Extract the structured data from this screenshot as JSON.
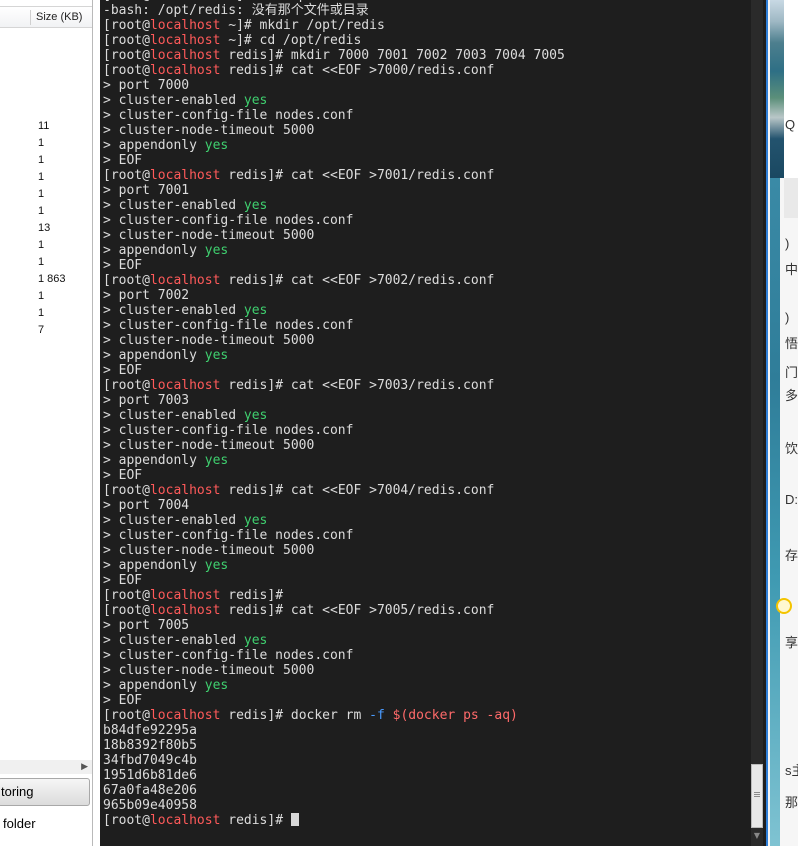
{
  "file_panel": {
    "size_column_header": "Size (KB)",
    "sizes": [
      "11",
      "1",
      "1",
      "1",
      "1",
      "1",
      "13",
      "1",
      "1",
      "1 863",
      "1",
      "1",
      "7"
    ],
    "storing_button_label": "toring",
    "folder_label": "folder"
  },
  "terminal": {
    "lines": [
      [
        {
          "t": "[root@"
        },
        {
          "t": "localhost",
          "c": "host"
        },
        {
          "t": " ~]# cd /opt/redis"
        }
      ],
      [
        {
          "t": "-bash: /opt/redis: 没有那个文件或目录"
        }
      ],
      [
        {
          "t": "[root@"
        },
        {
          "t": "localhost",
          "c": "host"
        },
        {
          "t": " ~]# mkdir /opt/redis"
        }
      ],
      [
        {
          "t": "[root@"
        },
        {
          "t": "localhost",
          "c": "host"
        },
        {
          "t": " ~]# cd /opt/redis"
        }
      ],
      [
        {
          "t": "[root@"
        },
        {
          "t": "localhost",
          "c": "host"
        },
        {
          "t": " redis]# mkdir 7000 7001 7002 7003 7004 7005"
        }
      ],
      [
        {
          "t": "[root@"
        },
        {
          "t": "localhost",
          "c": "host"
        },
        {
          "t": " redis]# cat <<EOF >7000/redis.conf"
        }
      ],
      [
        {
          "t": "> port 7000"
        }
      ],
      [
        {
          "t": "> cluster-enabled "
        },
        {
          "t": "yes",
          "c": "yes"
        }
      ],
      [
        {
          "t": "> cluster-config-file nodes.conf"
        }
      ],
      [
        {
          "t": "> cluster-node-timeout 5000"
        }
      ],
      [
        {
          "t": "> appendonly "
        },
        {
          "t": "yes",
          "c": "yes"
        }
      ],
      [
        {
          "t": "> EOF"
        }
      ],
      [
        {
          "t": "[root@"
        },
        {
          "t": "localhost",
          "c": "host"
        },
        {
          "t": " redis]# cat <<EOF >7001/redis.conf"
        }
      ],
      [
        {
          "t": "> port 7001"
        }
      ],
      [
        {
          "t": "> cluster-enabled "
        },
        {
          "t": "yes",
          "c": "yes"
        }
      ],
      [
        {
          "t": "> cluster-config-file nodes.conf"
        }
      ],
      [
        {
          "t": "> cluster-node-timeout 5000"
        }
      ],
      [
        {
          "t": "> appendonly "
        },
        {
          "t": "yes",
          "c": "yes"
        }
      ],
      [
        {
          "t": "> EOF"
        }
      ],
      [
        {
          "t": "[root@"
        },
        {
          "t": "localhost",
          "c": "host"
        },
        {
          "t": " redis]# cat <<EOF >7002/redis.conf"
        }
      ],
      [
        {
          "t": "> port 7002"
        }
      ],
      [
        {
          "t": "> cluster-enabled "
        },
        {
          "t": "yes",
          "c": "yes"
        }
      ],
      [
        {
          "t": "> cluster-config-file nodes.conf"
        }
      ],
      [
        {
          "t": "> cluster-node-timeout 5000"
        }
      ],
      [
        {
          "t": "> appendonly "
        },
        {
          "t": "yes",
          "c": "yes"
        }
      ],
      [
        {
          "t": "> EOF"
        }
      ],
      [
        {
          "t": "[root@"
        },
        {
          "t": "localhost",
          "c": "host"
        },
        {
          "t": " redis]# cat <<EOF >7003/redis.conf"
        }
      ],
      [
        {
          "t": "> port 7003"
        }
      ],
      [
        {
          "t": "> cluster-enabled "
        },
        {
          "t": "yes",
          "c": "yes"
        }
      ],
      [
        {
          "t": "> cluster-config-file nodes.conf"
        }
      ],
      [
        {
          "t": "> cluster-node-timeout 5000"
        }
      ],
      [
        {
          "t": "> appendonly "
        },
        {
          "t": "yes",
          "c": "yes"
        }
      ],
      [
        {
          "t": "> EOF"
        }
      ],
      [
        {
          "t": "[root@"
        },
        {
          "t": "localhost",
          "c": "host"
        },
        {
          "t": " redis]# cat <<EOF >7004/redis.conf"
        }
      ],
      [
        {
          "t": "> port 7004"
        }
      ],
      [
        {
          "t": "> cluster-enabled "
        },
        {
          "t": "yes",
          "c": "yes"
        }
      ],
      [
        {
          "t": "> cluster-config-file nodes.conf"
        }
      ],
      [
        {
          "t": "> cluster-node-timeout 5000"
        }
      ],
      [
        {
          "t": "> appendonly "
        },
        {
          "t": "yes",
          "c": "yes"
        }
      ],
      [
        {
          "t": "> EOF"
        }
      ],
      [
        {
          "t": "[root@"
        },
        {
          "t": "localhost",
          "c": "host"
        },
        {
          "t": " redis]#"
        }
      ],
      [
        {
          "t": "[root@"
        },
        {
          "t": "localhost",
          "c": "host"
        },
        {
          "t": " redis]# cat <<EOF >7005/redis.conf"
        }
      ],
      [
        {
          "t": "> port 7005"
        }
      ],
      [
        {
          "t": "> cluster-enabled "
        },
        {
          "t": "yes",
          "c": "yes"
        }
      ],
      [
        {
          "t": "> cluster-config-file nodes.conf"
        }
      ],
      [
        {
          "t": "> cluster-node-timeout 5000"
        }
      ],
      [
        {
          "t": "> appendonly "
        },
        {
          "t": "yes",
          "c": "yes"
        }
      ],
      [
        {
          "t": "> EOF"
        }
      ],
      [
        {
          "t": "[root@"
        },
        {
          "t": "localhost",
          "c": "host"
        },
        {
          "t": " redis]# docker rm "
        },
        {
          "t": "-f",
          "c": "flag"
        },
        {
          "t": " "
        },
        {
          "t": "$(docker ps -aq)",
          "c": "sub"
        }
      ],
      [
        {
          "t": "b84dfe92295a"
        }
      ],
      [
        {
          "t": "18b8392f80b5"
        }
      ],
      [
        {
          "t": "34fbd7049c4b"
        }
      ],
      [
        {
          "t": "1951d6b81de6"
        }
      ],
      [
        {
          "t": "67a0fa48e206"
        }
      ],
      [
        {
          "t": "965b09e40958"
        }
      ],
      [
        {
          "t": "[root@"
        },
        {
          "t": "localhost",
          "c": "host"
        },
        {
          "t": " redis]# "
        },
        {
          "cursor": true
        }
      ]
    ]
  },
  "right_window": {
    "glyphs": [
      "Q",
      ")",
      "中",
      ")",
      "悟",
      "门",
      "多",
      "饮",
      "D:",
      "存",
      "享",
      "s主",
      "那"
    ]
  }
}
